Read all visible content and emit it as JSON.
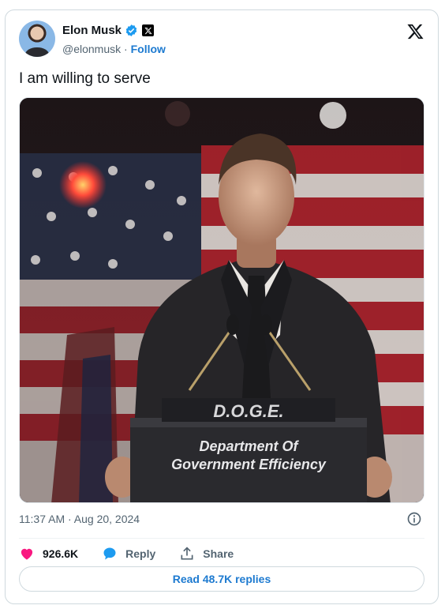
{
  "author": {
    "name": "Elon Musk",
    "handle": "@elonmusk",
    "separator": "·",
    "follow_label": "Follow"
  },
  "tweet": {
    "text": "I am willing to serve",
    "timestamp": "11:37 AM · Aug 20, 2024"
  },
  "media": {
    "podium_logo": "D.O.G.E.",
    "podium_line1": "Department Of",
    "podium_line2": "Government Efficiency"
  },
  "actions": {
    "likes": "926.6K",
    "reply_label": "Reply",
    "share_label": "Share"
  },
  "read_replies_label": "Read 48.7K replies",
  "colors": {
    "like": "#f91880",
    "reply": "#1d9bf0",
    "link": "#1d7ad0",
    "verified": "#1d9bf0"
  },
  "icons": [
    "verified-badge-icon",
    "x-affiliate-icon",
    "x-logo-icon",
    "info-icon",
    "heart-icon",
    "reply-bubble-icon",
    "share-icon"
  ]
}
